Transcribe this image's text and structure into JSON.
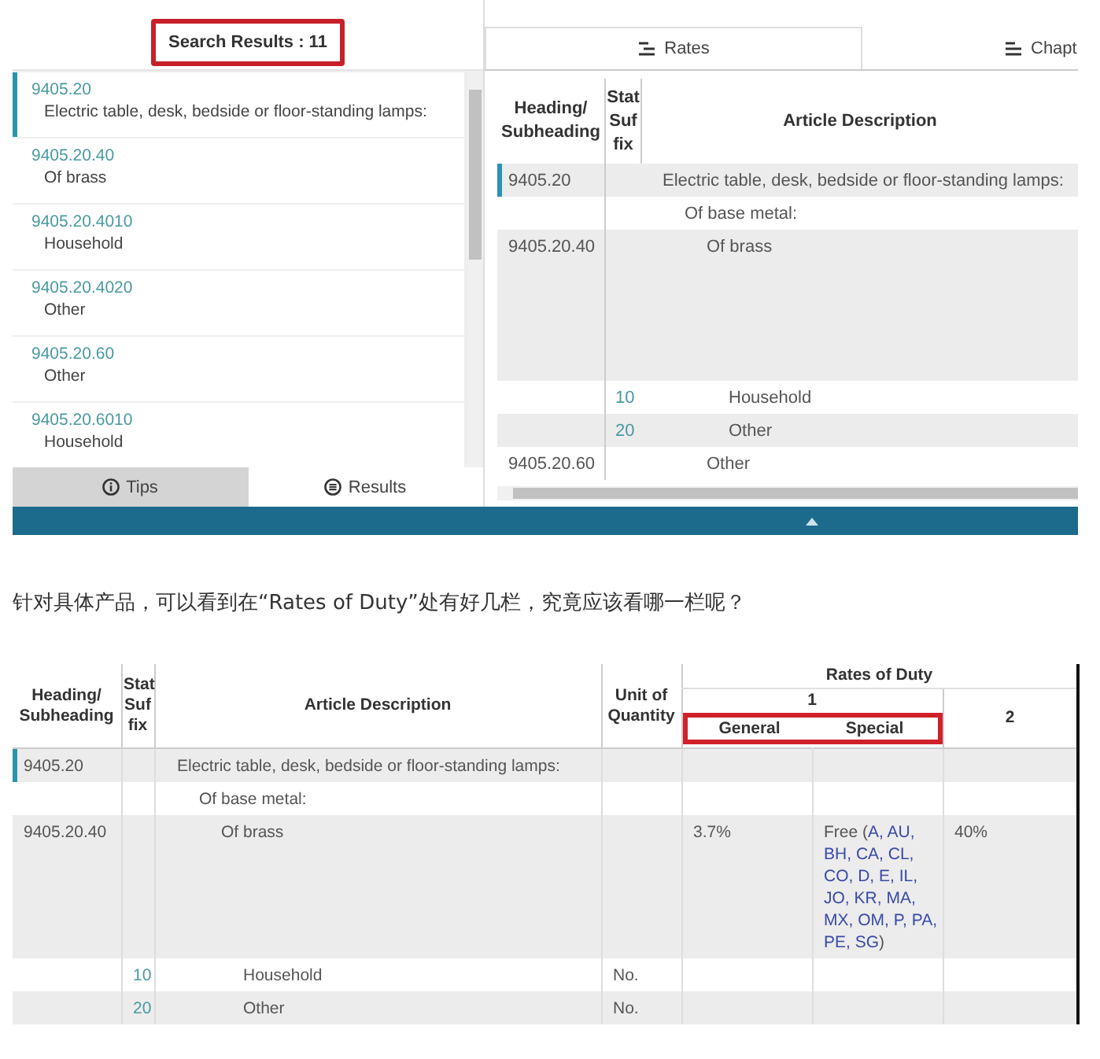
{
  "top_screenshot": {
    "search_results": {
      "label": "Search Results : 11",
      "highlighted": true
    },
    "results_list": [
      {
        "code": "9405.20",
        "description": "Electric table, desk, bedside or floor-standing lamps:",
        "selected": true
      },
      {
        "code": "9405.20.40",
        "description": "Of brass",
        "selected": false
      },
      {
        "code": "9405.20.4010",
        "description": "Household",
        "selected": false
      },
      {
        "code": "9405.20.4020",
        "description": "Other",
        "selected": false
      },
      {
        "code": "9405.20.60",
        "description": "Other",
        "selected": false
      },
      {
        "code": "9405.20.6010",
        "description": "Household",
        "selected": false
      }
    ],
    "panel_tabs": [
      {
        "label": "Tips",
        "selected": false
      },
      {
        "label": "Results",
        "selected": true
      }
    ],
    "view_tabs": [
      {
        "label": "Rates",
        "selected": true
      },
      {
        "label": "Chapt",
        "selected": false
      }
    ],
    "table": {
      "columns": [
        "Heading/ Subheading",
        "Stat Suf fix",
        "Article Description"
      ],
      "rows": [
        {
          "heading": "9405.20",
          "description": "Electric table, desk, bedside or floor-standing lamps:",
          "selected": true,
          "children": [
            {
              "description": "Of base metal:",
              "selected": false,
              "children": [
                {
                  "heading": "9405.20.40",
                  "description": "Of brass",
                  "selected": false,
                  "children": [
                    {
                      "stat_suffix": "10",
                      "description": "Household",
                      "selected": false
                    },
                    {
                      "stat_suffix": "20",
                      "description": "Other",
                      "selected": false
                    }
                  ]
                },
                {
                  "heading": "9405.20.60",
                  "description": "Other",
                  "selected": false
                }
              ]
            }
          ]
        }
      ]
    }
  },
  "caption": "针对具体产品，可以看到在“Rates of Duty”处有好几栏，究竟应该看哪一栏呢？",
  "rates_table": {
    "columns": {
      "heading": "Heading/ Subheading",
      "stat_suffix": "Stat Suf fix",
      "description": "Article Description",
      "unit": "Unit of Quantity",
      "rates_of_duty": "Rates of Duty",
      "column_1": "1",
      "general": "General",
      "special": "Special",
      "column_2": "2"
    },
    "general_special_highlighted": true,
    "rows": [
      {
        "heading": "9405.20",
        "description": "Electric table, desk, bedside or floor-standing lamps:",
        "selected": true,
        "children": [
          {
            "description": "Of base metal:",
            "selected": false,
            "children": [
              {
                "heading": "9405.20.40",
                "description": "Of brass",
                "selected": false,
                "general": "3.7%",
                "special": {
                  "text": "Free (",
                  "links": [
                    "A,",
                    "AU,",
                    "BH,",
                    "CA,",
                    "CL,",
                    "CO,",
                    "D,",
                    "E,",
                    "IL,",
                    "JO,",
                    "KR,",
                    "MA,",
                    "MX,",
                    "OM,",
                    "P,",
                    "PA,",
                    "PE,",
                    "SG"
                  ],
                  "end": ")"
                },
                "column_2": "40%",
                "children": [
                  {
                    "stat_suffix": "10",
                    "description": "Household",
                    "unit": "No.",
                    "selected": false
                  },
                  {
                    "stat_suffix": "20",
                    "description": "Other",
                    "unit": "No.",
                    "selected": false
                  }
                ]
              }
            ]
          }
        ]
      }
    ]
  }
}
